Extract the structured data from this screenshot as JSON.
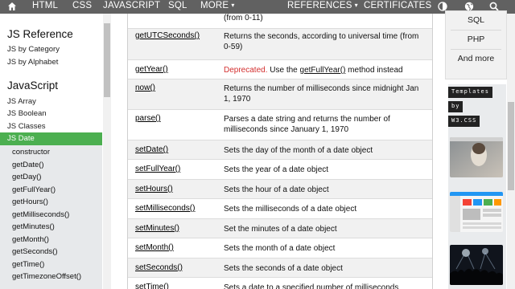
{
  "nav": {
    "home_icon": "home-icon",
    "items": [
      "HTML",
      "CSS",
      "JAVASCRIPT",
      "SQL",
      "MORE"
    ],
    "more_caret": "▾",
    "references": "REFERENCES",
    "references_caret": "▾",
    "certificates": "CERTIFICATES",
    "icons": [
      "contrast-icon",
      "globe-icon",
      "search-icon"
    ]
  },
  "sidebar": {
    "heading1": "JS Reference",
    "links1": [
      "JS by Category",
      "JS by Alphabet"
    ],
    "heading2": "JavaScript",
    "links2": [
      "JS Array",
      "JS Boolean",
      "JS Classes"
    ],
    "active": "JS Date",
    "sub_items": [
      "constructor",
      "getDate()",
      "getDay()",
      "getFullYear()",
      "getHours()",
      "getMilliseconds()",
      "getMinutes()",
      "getMonth()",
      "getSeconds()",
      "getTime()",
      "getTimezoneOffset()"
    ]
  },
  "table": {
    "rows": [
      {
        "method": "",
        "desc": "(from 0-11)"
      },
      {
        "method": "getUTCSeconds()",
        "desc": "Returns the seconds, according to universal time (from 0-59)"
      },
      {
        "method": "getYear()",
        "desc_deprecated": "Deprecated.",
        "desc_mid": " Use the ",
        "desc_link": "getFullYear()",
        "desc_end": " method instead"
      },
      {
        "method": "now()",
        "desc": "Returns the number of milliseconds since midnight Jan 1, 1970"
      },
      {
        "method": "parse()",
        "desc": "Parses a date string and returns the number of milliseconds since January 1, 1970"
      },
      {
        "method": "setDate()",
        "desc": "Sets the day of the month of a date object"
      },
      {
        "method": "setFullYear()",
        "desc": "Sets the year of a date object"
      },
      {
        "method": "setHours()",
        "desc": "Sets the hour of a date object"
      },
      {
        "method": "setMilliseconds()",
        "desc": "Sets the milliseconds of a date object"
      },
      {
        "method": "setMinutes()",
        "desc": "Set the minutes of a date object"
      },
      {
        "method": "setMonth()",
        "desc": "Sets the month of a date object"
      },
      {
        "method": "setSeconds()",
        "desc": "Sets the seconds of a date object"
      },
      {
        "method": "setTime()",
        "desc": "Sets a date to a specified number of milliseconds"
      }
    ]
  },
  "right_menu": [
    "SQL",
    "PHP",
    "And more"
  ],
  "ad": {
    "tag1": "Templates",
    "tag2": "by",
    "tag3": "W3.CSS"
  },
  "colors": {
    "nav_bg": "#616161",
    "active_green": "#4caf50",
    "deprecated_red": "#d32f2f"
  }
}
